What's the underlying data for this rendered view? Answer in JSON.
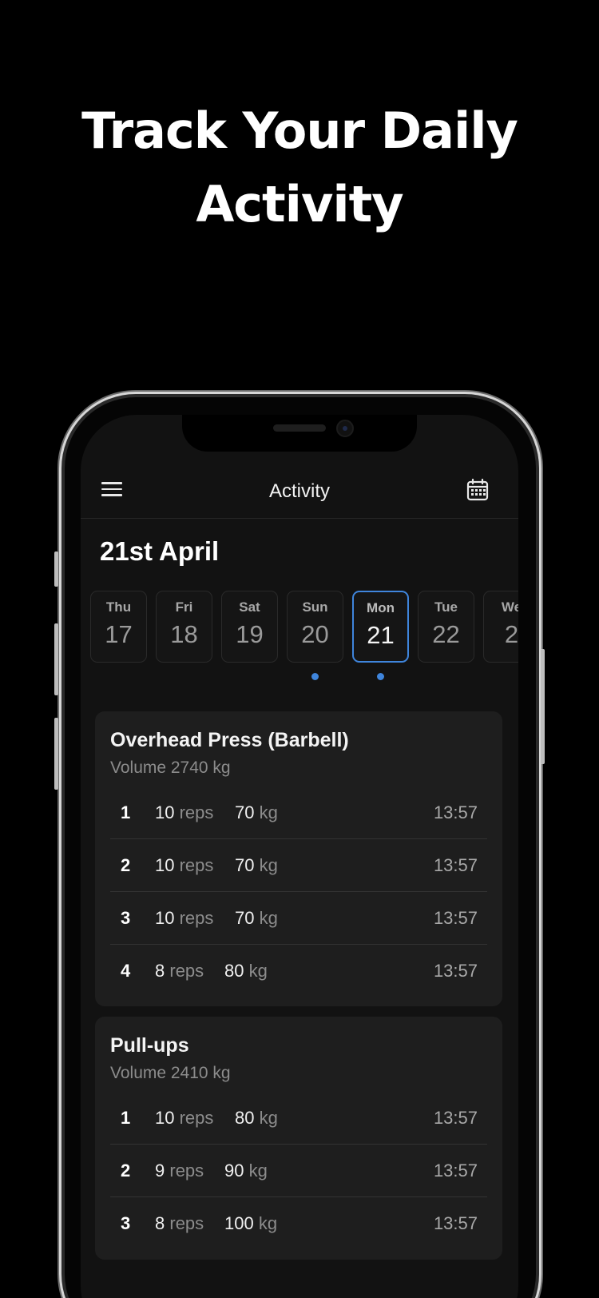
{
  "headline": {
    "line1": "Track Your Daily",
    "line2": "Activity"
  },
  "appbar": {
    "title": "Activity",
    "menu_icon": "hamburger-menu-icon",
    "calendar_icon": "calendar-icon"
  },
  "date_title": "21st April",
  "accent_color": "#3f85dc",
  "days": [
    {
      "name": "Thu",
      "num": "17",
      "selected": false,
      "dot": false
    },
    {
      "name": "Fri",
      "num": "18",
      "selected": false,
      "dot": false
    },
    {
      "name": "Sat",
      "num": "19",
      "selected": false,
      "dot": false
    },
    {
      "name": "Sun",
      "num": "20",
      "selected": false,
      "dot": true
    },
    {
      "name": "Mon",
      "num": "21",
      "selected": true,
      "dot": true
    },
    {
      "name": "Tue",
      "num": "22",
      "selected": false,
      "dot": false
    },
    {
      "name": "We",
      "num": "2",
      "selected": false,
      "dot": false
    }
  ],
  "exercises": [
    {
      "title": "Overhead Press (Barbell)",
      "volume": "Volume 2740 kg",
      "sets": [
        {
          "n": "1",
          "reps": "10",
          "reps_unit": "reps",
          "weight": "70",
          "weight_unit": "kg",
          "time": "13:57"
        },
        {
          "n": "2",
          "reps": "10",
          "reps_unit": "reps",
          "weight": "70",
          "weight_unit": "kg",
          "time": "13:57"
        },
        {
          "n": "3",
          "reps": "10",
          "reps_unit": "reps",
          "weight": "70",
          "weight_unit": "kg",
          "time": "13:57"
        },
        {
          "n": "4",
          "reps": "8",
          "reps_unit": "reps",
          "weight": "80",
          "weight_unit": "kg",
          "time": "13:57"
        }
      ]
    },
    {
      "title": "Pull-ups",
      "volume": "Volume 2410 kg",
      "sets": [
        {
          "n": "1",
          "reps": "10",
          "reps_unit": "reps",
          "weight": "80",
          "weight_unit": "kg",
          "time": "13:57"
        },
        {
          "n": "2",
          "reps": "9",
          "reps_unit": "reps",
          "weight": "90",
          "weight_unit": "kg",
          "time": "13:57"
        },
        {
          "n": "3",
          "reps": "8",
          "reps_unit": "reps",
          "weight": "100",
          "weight_unit": "kg",
          "time": "13:57"
        }
      ]
    }
  ]
}
